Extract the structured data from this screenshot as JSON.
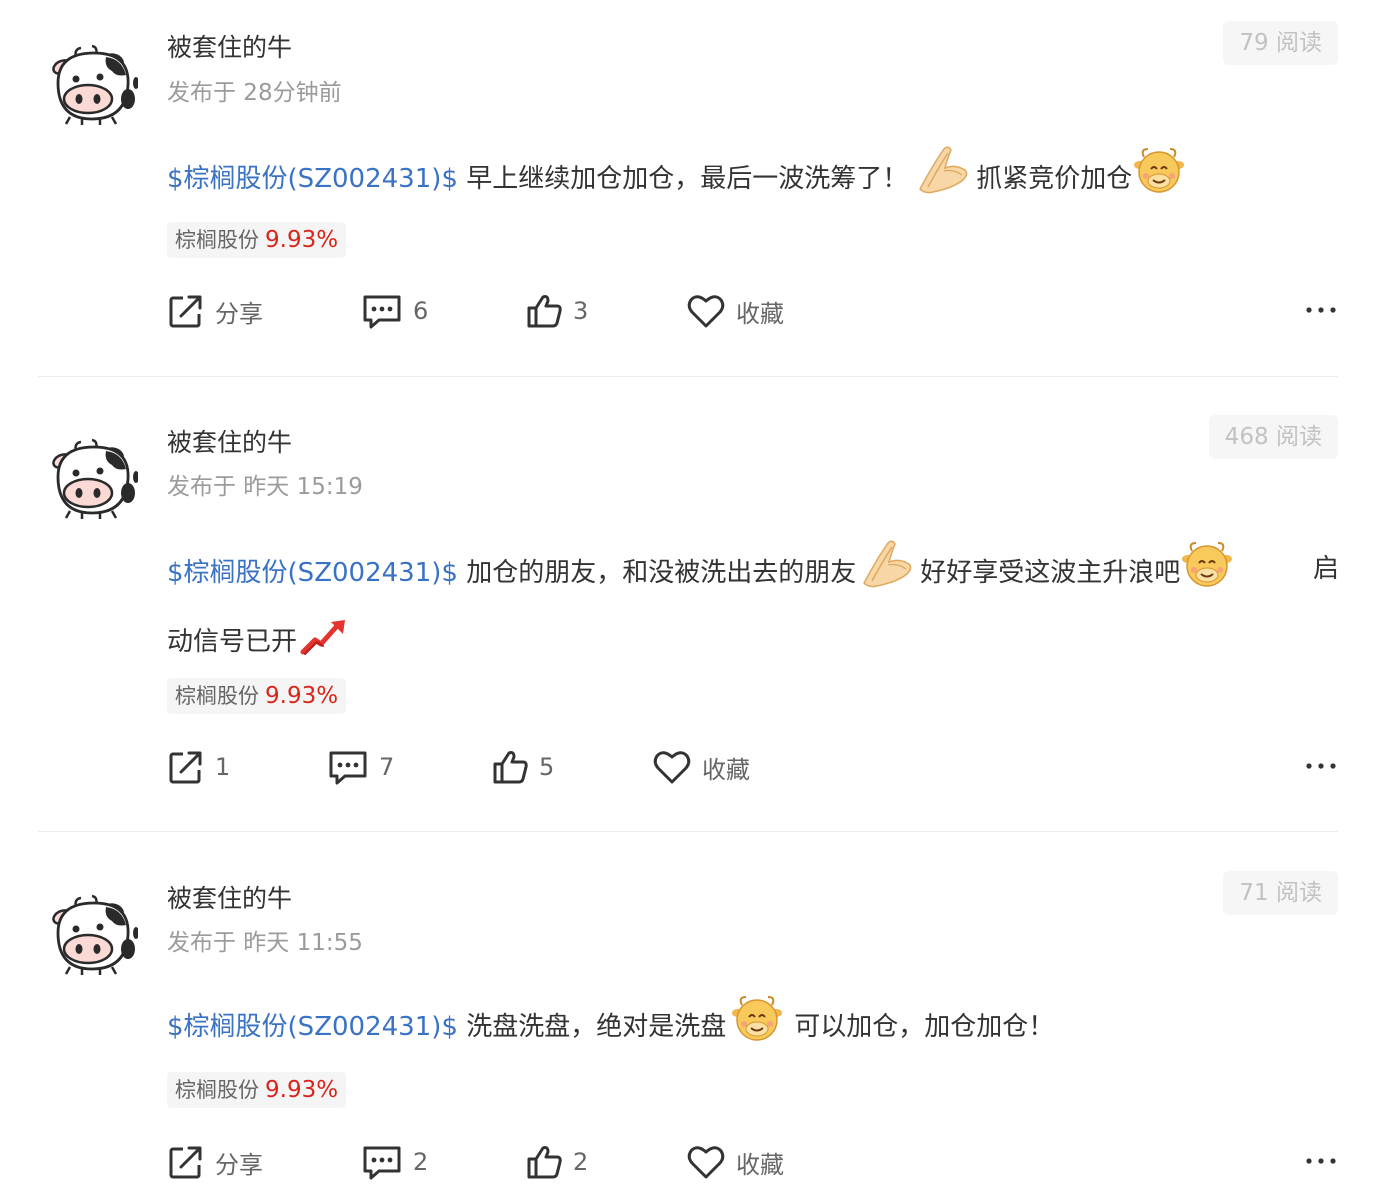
{
  "posts": [
    {
      "author": "被套住的牛",
      "published": "发布于 28分钟前",
      "reads": "79 阅读",
      "content_lines": [
        [
          {
            "type": "link",
            "text": "$棕榈股份(SZ002431)$"
          },
          {
            "type": "text",
            "text": " 早上继续加仓加仓，最后一波洗筹了！"
          },
          {
            "type": "emoji",
            "icon": "praying-hands-icon"
          },
          {
            "type": "text",
            "text": "抓紧竞价加仓"
          },
          {
            "type": "emoji",
            "icon": "cow-face-icon"
          }
        ]
      ],
      "stock_tag": {
        "name": "棕榈股份",
        "change": "9.93%"
      },
      "actions": {
        "share": "分享",
        "comments": "6",
        "likes": "3",
        "favorite": "收藏"
      }
    },
    {
      "author": "被套住的牛",
      "published": "发布于 昨天 15:19",
      "reads": "468 阅读",
      "content_lines": [
        [
          {
            "type": "link",
            "text": "$棕榈股份(SZ002431)$"
          },
          {
            "type": "text",
            "text": " 加仓的朋友，和没被洗出去的朋友"
          },
          {
            "type": "emoji",
            "icon": "praying-hands-icon"
          },
          {
            "type": "text",
            "text": "好好享受这波主升浪吧"
          },
          {
            "type": "emoji",
            "icon": "cow-face-icon"
          },
          {
            "type": "text",
            "text": "启"
          }
        ],
        [
          {
            "type": "text",
            "text": "动信号已开"
          },
          {
            "type": "emoji",
            "icon": "trend-up-icon"
          }
        ]
      ],
      "stock_tag": {
        "name": "棕榈股份",
        "change": "9.93%"
      },
      "actions": {
        "share": "1",
        "comments": "7",
        "likes": "5",
        "favorite": "收藏"
      }
    },
    {
      "author": "被套住的牛",
      "published": "发布于 昨天 11:55",
      "reads": "71 阅读",
      "content_lines": [
        [
          {
            "type": "link",
            "text": "$棕榈股份(SZ002431)$"
          },
          {
            "type": "text",
            "text": " 洗盘洗盘，绝对是洗盘"
          },
          {
            "type": "emoji",
            "icon": "cow-face-icon"
          },
          {
            "type": "text",
            "text": "可以加仓，加仓加仓！"
          }
        ]
      ],
      "stock_tag": {
        "name": "棕榈股份",
        "change": "9.93%"
      },
      "actions": {
        "share": "分享",
        "comments": "2",
        "likes": "2",
        "favorite": "收藏"
      }
    }
  ],
  "colors": {
    "link": "#3a72c6",
    "gain": "#d9251c",
    "muted": "#9b9b9b"
  },
  "icons": {
    "avatar": "cow-avatar-icon",
    "share": "share-icon",
    "comment": "comment-icon",
    "like": "thumbs-up-icon",
    "favorite": "heart-icon",
    "more": "more-icon"
  }
}
